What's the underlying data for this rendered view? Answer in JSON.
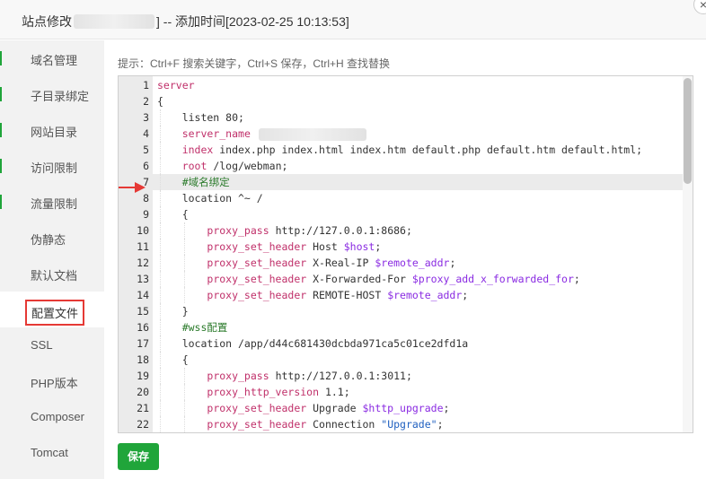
{
  "dialog": {
    "title_prefix": "站点修改",
    "title_suffix": "] -- 添加时间[2023-02-25 10:13:53]",
    "close_icon": "close-icon"
  },
  "sidebar": {
    "items": [
      {
        "label": "域名管理"
      },
      {
        "label": "子目录绑定"
      },
      {
        "label": "网站目录"
      },
      {
        "label": "访问限制"
      },
      {
        "label": "流量限制"
      },
      {
        "label": "伪静态"
      },
      {
        "label": "默认文档"
      },
      {
        "label": "配置文件",
        "active": true
      },
      {
        "label": "SSL"
      },
      {
        "label": "PHP版本"
      },
      {
        "label": "Composer"
      },
      {
        "label": "Tomcat"
      }
    ]
  },
  "tip": "提示：Ctrl+F 搜索关键字，Ctrl+S 保存，Ctrl+H 查找替换",
  "editor": {
    "active_line": 7,
    "lines": [
      {
        "n": "1",
        "t": [
          {
            "c": "k",
            "v": "server"
          }
        ]
      },
      {
        "n": "2",
        "t": [
          {
            "c": "",
            "v": "{"
          }
        ]
      },
      {
        "n": "3",
        "t": [
          {
            "c": "",
            "v": "    listen 80;"
          }
        ]
      },
      {
        "n": "4",
        "t": [
          {
            "c": "",
            "v": "    "
          },
          {
            "c": "k",
            "v": "server_name"
          }
        ]
      },
      {
        "n": "5",
        "t": [
          {
            "c": "",
            "v": "    "
          },
          {
            "c": "k",
            "v": "index"
          },
          {
            "c": "",
            "v": " index.php index.html index.htm default.php default.htm default.html;"
          }
        ]
      },
      {
        "n": "6",
        "t": [
          {
            "c": "",
            "v": "    "
          },
          {
            "c": "k",
            "v": "root"
          },
          {
            "c": "",
            "v": " /log/webman;"
          }
        ]
      },
      {
        "n": "7",
        "t": [
          {
            "c": "",
            "v": "    "
          },
          {
            "c": "c",
            "v": "#域名绑定"
          }
        ]
      },
      {
        "n": "8",
        "t": [
          {
            "c": "",
            "v": "    location ^~ /"
          }
        ]
      },
      {
        "n": "9",
        "t": [
          {
            "c": "",
            "v": "    {"
          }
        ]
      },
      {
        "n": "10",
        "t": [
          {
            "c": "",
            "v": "        "
          },
          {
            "c": "k",
            "v": "proxy_pass"
          },
          {
            "c": "",
            "v": " http://127.0.0.1:8686;"
          }
        ]
      },
      {
        "n": "11",
        "t": [
          {
            "c": "",
            "v": "        "
          },
          {
            "c": "k",
            "v": "proxy_set_header"
          },
          {
            "c": "",
            "v": " Host "
          },
          {
            "c": "v",
            "v": "$host"
          },
          {
            "c": "",
            "v": ";"
          }
        ]
      },
      {
        "n": "12",
        "t": [
          {
            "c": "",
            "v": "        "
          },
          {
            "c": "k",
            "v": "proxy_set_header"
          },
          {
            "c": "",
            "v": " X-Real-IP "
          },
          {
            "c": "v",
            "v": "$remote_addr"
          },
          {
            "c": "",
            "v": ";"
          }
        ]
      },
      {
        "n": "13",
        "t": [
          {
            "c": "",
            "v": "        "
          },
          {
            "c": "k",
            "v": "proxy_set_header"
          },
          {
            "c": "",
            "v": " X-Forwarded-For "
          },
          {
            "c": "v",
            "v": "$proxy_add_x_forwarded_for"
          },
          {
            "c": "",
            "v": ";"
          }
        ]
      },
      {
        "n": "14",
        "t": [
          {
            "c": "",
            "v": "        "
          },
          {
            "c": "k",
            "v": "proxy_set_header"
          },
          {
            "c": "",
            "v": " REMOTE-HOST "
          },
          {
            "c": "v",
            "v": "$remote_addr"
          },
          {
            "c": "",
            "v": ";"
          }
        ]
      },
      {
        "n": "15",
        "t": [
          {
            "c": "",
            "v": "    }"
          }
        ]
      },
      {
        "n": "16",
        "t": [
          {
            "c": "",
            "v": "    "
          },
          {
            "c": "c",
            "v": "#wss配置"
          }
        ]
      },
      {
        "n": "17",
        "t": [
          {
            "c": "",
            "v": "    location /app/d44c681430dcbda971ca5c01ce2dfd1a"
          }
        ]
      },
      {
        "n": "18",
        "t": [
          {
            "c": "",
            "v": "    {"
          }
        ]
      },
      {
        "n": "19",
        "t": [
          {
            "c": "",
            "v": "        "
          },
          {
            "c": "k",
            "v": "proxy_pass"
          },
          {
            "c": "",
            "v": " http://127.0.0.1:3011;"
          }
        ]
      },
      {
        "n": "20",
        "t": [
          {
            "c": "",
            "v": "        "
          },
          {
            "c": "k",
            "v": "proxy_http_version"
          },
          {
            "c": "",
            "v": " 1.1;"
          }
        ]
      },
      {
        "n": "21",
        "t": [
          {
            "c": "",
            "v": "        "
          },
          {
            "c": "k",
            "v": "proxy_set_header"
          },
          {
            "c": "",
            "v": " Upgrade "
          },
          {
            "c": "v",
            "v": "$http_upgrade"
          },
          {
            "c": "",
            "v": ";"
          }
        ]
      },
      {
        "n": "22",
        "t": [
          {
            "c": "",
            "v": "        "
          },
          {
            "c": "k",
            "v": "proxy_set_header"
          },
          {
            "c": "",
            "v": " Connection "
          },
          {
            "c": "s",
            "v": "\"Upgrade\""
          },
          {
            "c": "",
            "v": ";"
          }
        ]
      }
    ]
  },
  "save_button": "保存",
  "colors": {
    "accent": "#20a53a",
    "highlight_box": "#e53935",
    "keyword": "#c0306a",
    "variable": "#8a2be2",
    "string": "#2060c0",
    "comment": "#2a7a2a"
  }
}
